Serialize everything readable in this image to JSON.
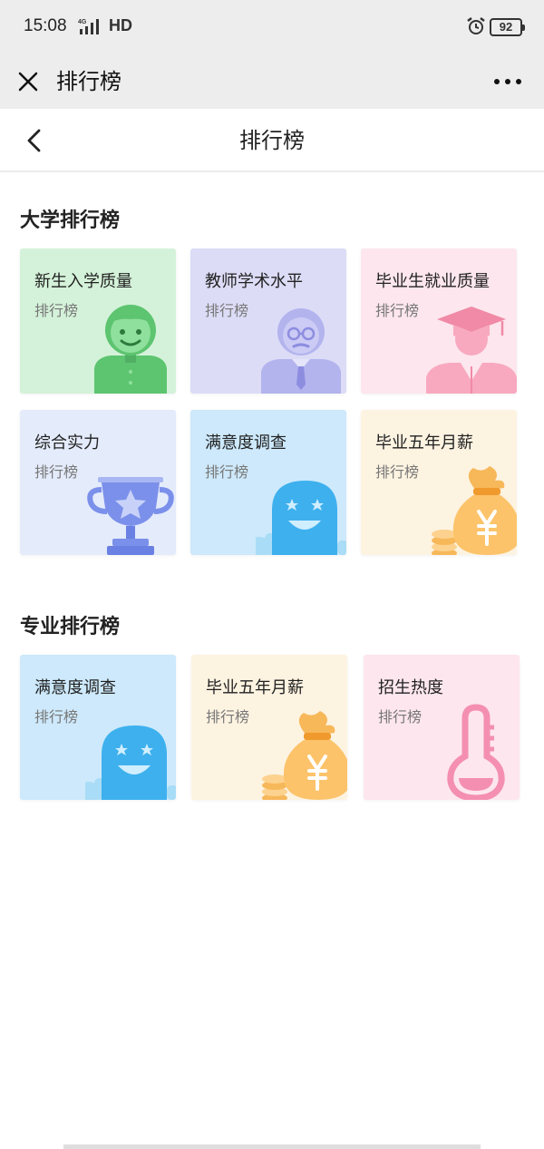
{
  "status_bar": {
    "time": "15:08",
    "network": "4G",
    "hd": "HD",
    "battery": "92"
  },
  "title_bar": {
    "title": "排行榜",
    "close_icon": "close-icon",
    "more_icon": "more-icon"
  },
  "nav": {
    "title": "排行榜",
    "back_icon": "chevron-left-icon"
  },
  "sections": [
    {
      "title": "大学排行榜",
      "cards": [
        {
          "title": "新生入学质量",
          "subtitle": "排行榜",
          "icon": "student-icon",
          "bg": "#d4f2d9"
        },
        {
          "title": "教师学术水平",
          "subtitle": "排行榜",
          "icon": "professor-icon",
          "bg": "#dcdcf7"
        },
        {
          "title": "毕业生就业质量",
          "subtitle": "排行榜",
          "icon": "graduate-icon",
          "bg": "#fde6ee"
        },
        {
          "title": "综合实力",
          "subtitle": "排行榜",
          "icon": "trophy-icon",
          "bg": "#e4ebfb"
        },
        {
          "title": "满意度调查",
          "subtitle": "排行榜",
          "icon": "smiley-icon",
          "bg": "#cde9fb"
        },
        {
          "title": "毕业五年月薪",
          "subtitle": "排行榜",
          "icon": "money-bag-icon",
          "bg": "#fdf3e1"
        }
      ]
    },
    {
      "title": "专业排行榜",
      "cards": [
        {
          "title": "满意度调查",
          "subtitle": "排行榜",
          "icon": "smiley-icon",
          "bg": "#cde9fb"
        },
        {
          "title": "毕业五年月薪",
          "subtitle": "排行榜",
          "icon": "money-bag-icon",
          "bg": "#fdf3e1"
        },
        {
          "title": "招生热度",
          "subtitle": "排行榜",
          "icon": "thermometer-icon",
          "bg": "#fde6ee"
        }
      ]
    }
  ]
}
